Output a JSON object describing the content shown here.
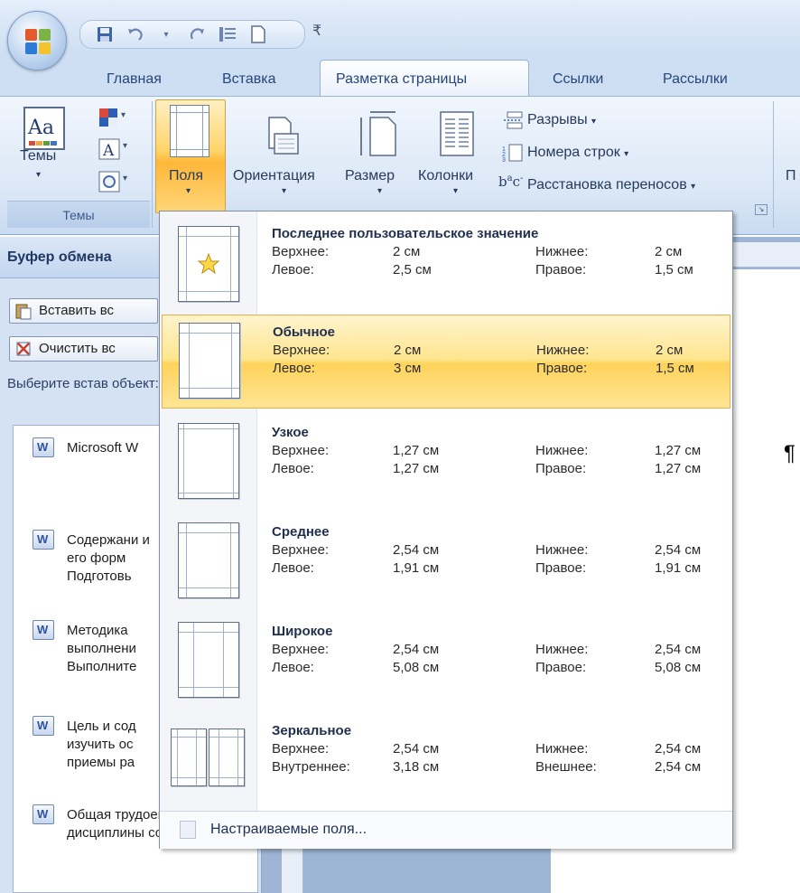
{
  "tabs": [
    {
      "label": "Главная"
    },
    {
      "label": "Вставка"
    },
    {
      "label": "Разметка страницы",
      "active": true
    },
    {
      "label": "Ссылки"
    },
    {
      "label": "Рассылки"
    }
  ],
  "ribbon": {
    "themes": {
      "button_label": "Темы",
      "group_label": "Темы"
    },
    "margins_button_label": "Поля",
    "orientation_button_label": "Ориентация",
    "size_button_label": "Размер",
    "columns_button_label": "Колонки",
    "breaks_label": "Разрывы",
    "line_numbers_label": "Номера строк",
    "hyphenation_label": "Расстановка переносов",
    "cut_off_label": "П"
  },
  "clipboard_pane": {
    "title": "Буфер обмена",
    "paste_all_label": "Вставить вс",
    "clear_all_label": "Очистить вс",
    "hint": "Выберите встав объект:",
    "items": [
      {
        "text": "Microsoft W"
      },
      {
        "text": "Содержани и его форм Подготовь"
      },
      {
        "text": "Методика выполнени Выполните"
      },
      {
        "text": "Цель и сод изучить ос приемы ра"
      },
      {
        "text": "Общая трудоемко дисциплины соста..."
      }
    ]
  },
  "doc": {
    "paragraph_mark": "¶"
  },
  "margins_menu": {
    "options": [
      {
        "title": "Последнее пользовательское значение",
        "r1": [
          "Верхнее:",
          "2 см",
          "Нижнее:",
          "2 см"
        ],
        "r2": [
          "Левое:",
          "2,5 см",
          "Правое:",
          "1,5 см"
        ]
      },
      {
        "title": "Обычное",
        "r1": [
          "Верхнее:",
          "2 см",
          "Нижнее:",
          "2 см"
        ],
        "r2": [
          "Левое:",
          "3 см",
          "Правое:",
          "1,5 см"
        ],
        "selected": true
      },
      {
        "title": "Узкое",
        "r1": [
          "Верхнее:",
          "1,27 см",
          "Нижнее:",
          "1,27 см"
        ],
        "r2": [
          "Левое:",
          "1,27 см",
          "Правое:",
          "1,27 см"
        ]
      },
      {
        "title": "Среднее",
        "r1": [
          "Верхнее:",
          "2,54 см",
          "Нижнее:",
          "2,54 см"
        ],
        "r2": [
          "Левое:",
          "1,91 см",
          "Правое:",
          "1,91 см"
        ]
      },
      {
        "title": "Широкое",
        "r1": [
          "Верхнее:",
          "2,54 см",
          "Нижнее:",
          "2,54 см"
        ],
        "r2": [
          "Левое:",
          "5,08 см",
          "Правое:",
          "5,08 см"
        ]
      },
      {
        "title": "Зеркальное",
        "r1": [
          "Верхнее:",
          "2,54 см",
          "Нижнее:",
          "2,54 см"
        ],
        "r2": [
          "Внутреннее:",
          "3,18 см",
          "Внешнее:",
          "2,54 см"
        ]
      }
    ],
    "custom_label": "Настраиваемые поля..."
  },
  "colors": {
    "selected_highlight": "#ffd35b",
    "accent_blue": "#25467b",
    "ribbon_bg": "#dae7f6"
  }
}
